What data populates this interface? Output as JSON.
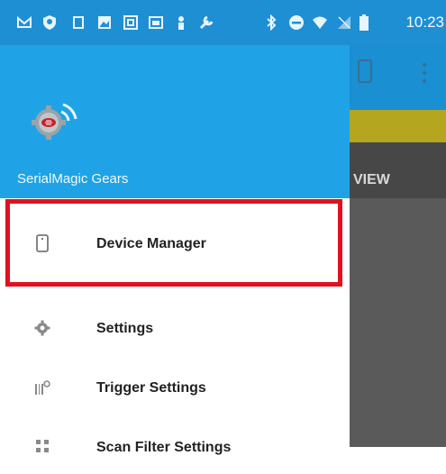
{
  "status_bar": {
    "time": "10:23",
    "left_icons": [
      "gmail-icon",
      "shield-icon",
      "square-icon",
      "photo-icon",
      "image-icon",
      "calendar-icon",
      "person-icon",
      "wrench-icon"
    ],
    "right_icons": [
      "bluetooth-icon",
      "do-not-disturb-icon",
      "wifi-icon",
      "no-signal-icon",
      "battery-icon"
    ]
  },
  "drawer": {
    "app_name": "SerialMagic Gears",
    "items": [
      {
        "label": "Device Manager",
        "icon": "phone-icon"
      },
      {
        "label": "Settings",
        "icon": "gear-icon"
      },
      {
        "label": "Trigger Settings",
        "icon": "barcode-gear-icon"
      },
      {
        "label": "Scan Filter Settings",
        "icon": "filter-icon"
      }
    ]
  },
  "background_app": {
    "tab_label": "VIEW"
  },
  "colors": {
    "status_bar": "#1f8fd4",
    "drawer_header": "#1fa3e6",
    "highlight": "#e0121f"
  }
}
